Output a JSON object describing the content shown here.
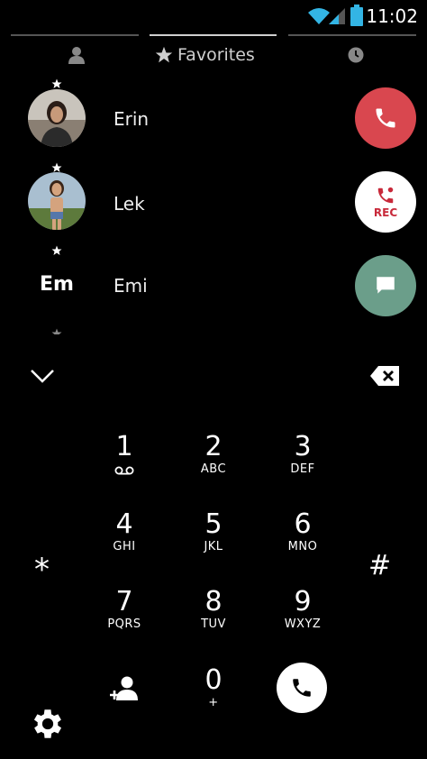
{
  "status_bar": {
    "time": "11:02"
  },
  "tabs": [
    {
      "name": "contacts",
      "label": ""
    },
    {
      "name": "favorites",
      "label": "Favorites"
    },
    {
      "name": "recents",
      "label": ""
    }
  ],
  "favorites": [
    {
      "name": "Erin"
    },
    {
      "name": "Lek"
    },
    {
      "name": "Emi",
      "initials": "Em"
    }
  ],
  "actions": {
    "record_label": "REC"
  },
  "dialpad": {
    "keys": [
      {
        "digit": "1",
        "letters": ""
      },
      {
        "digit": "2",
        "letters": "ABC"
      },
      {
        "digit": "3",
        "letters": "DEF"
      },
      {
        "digit": "4",
        "letters": "GHI"
      },
      {
        "digit": "5",
        "letters": "JKL"
      },
      {
        "digit": "6",
        "letters": "MNO"
      },
      {
        "digit": "7",
        "letters": "PQRS"
      },
      {
        "digit": "8",
        "letters": "TUV"
      },
      {
        "digit": "9",
        "letters": "WXYZ"
      },
      {
        "digit": "0",
        "letters": "+"
      }
    ],
    "star": "*",
    "hash": "#"
  },
  "colors": {
    "call_red": "#d9474f",
    "message_teal": "#6b9e8a",
    "record_red": "#c8293a",
    "background": "#000000"
  }
}
